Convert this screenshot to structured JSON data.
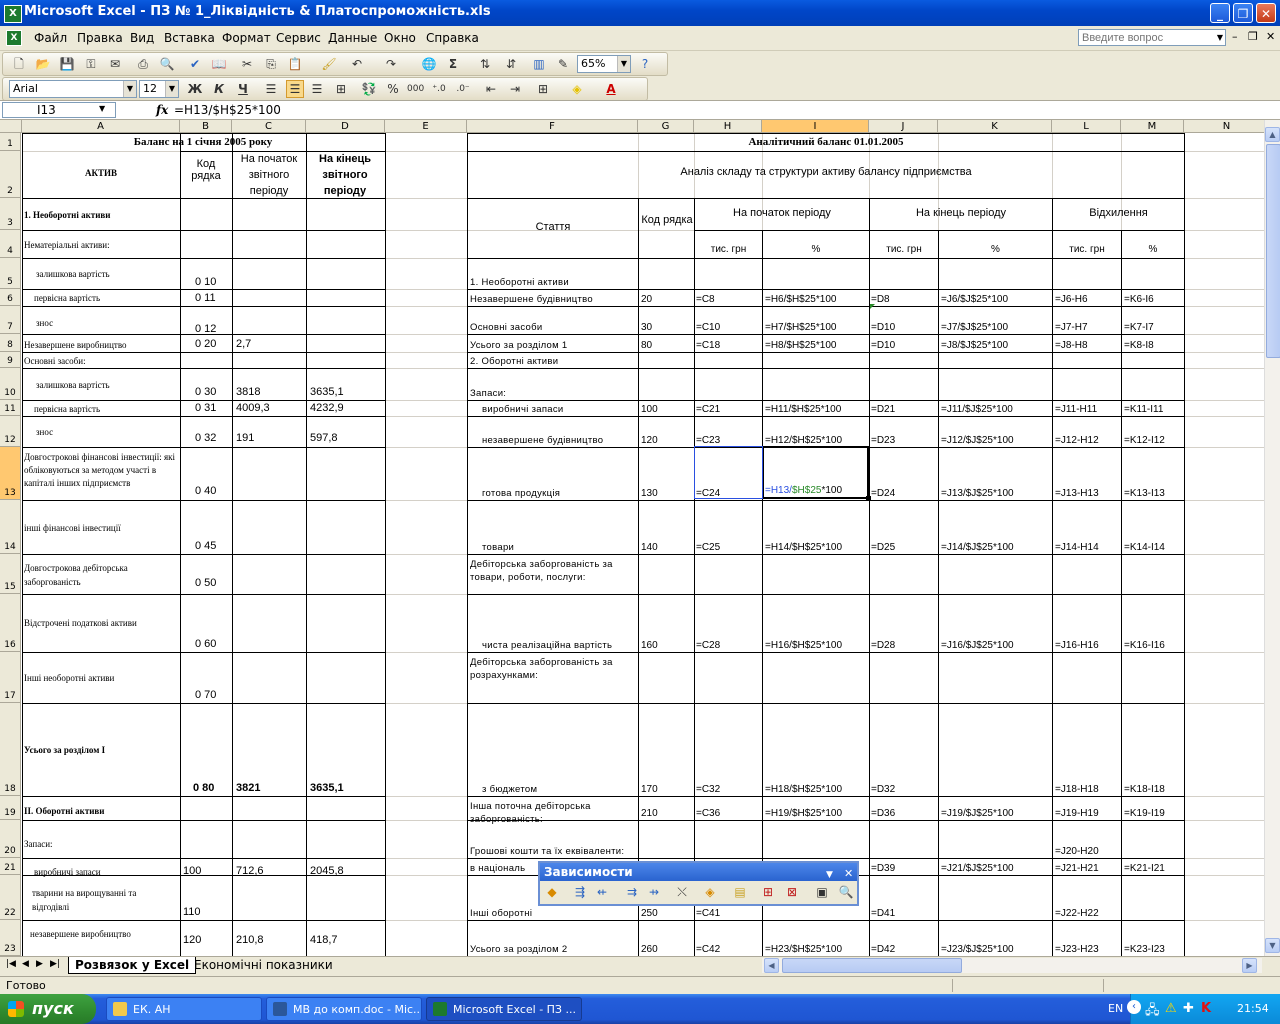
{
  "window": {
    "title": "Microsoft Excel - ПЗ № 1_Ліквідність & Платоспроможність.xls"
  },
  "menu": {
    "items": [
      "Файл",
      "Правка",
      "Вид",
      "Вставка",
      "Формат",
      "Сервис",
      "Данные",
      "Окно",
      "Справка"
    ],
    "help_placeholder": "Введите вопрос"
  },
  "toolbar": {
    "zoom": "65%",
    "font": "Arial",
    "size": "12",
    "bold": "Ж",
    "italic": "К",
    "underline": "Ч"
  },
  "formula_bar": {
    "cell_ref": "I13",
    "fx": "fx",
    "formula": "=H13/$H$25*100"
  },
  "columns": [
    "A",
    "B",
    "C",
    "D",
    "E",
    "F",
    "G",
    "H",
    "I",
    "J",
    "K",
    "L",
    "M",
    "N"
  ],
  "active_cell": {
    "col": "I",
    "row": "13"
  },
  "rows": [
    "1",
    "2",
    "3",
    "4",
    "5",
    "6",
    "7",
    "8",
    "9",
    "10",
    "11",
    "12",
    "13",
    "14",
    "15",
    "16",
    "17",
    "18",
    "19",
    "20",
    "21",
    "22",
    "23"
  ],
  "left_table": {
    "title": "Баланс на 1 січня 2005 року",
    "hdr_activ": "АКТИВ",
    "hdr_code": "Код рядка",
    "hdr_start": "На початок звітного періоду",
    "hdr_end": "На кінець звітного періоду",
    "r3": "1. Необоротні активи",
    "r4": "Нематеріальні активи:",
    "r5": "залишкова вартість",
    "r5_code": "0 10",
    "r6": "первісна вартість",
    "r6_code": "0 11",
    "r7": "знос",
    "r7_code": "0 12",
    "r8": "Незавершене виробництво",
    "r8_code": "0 20",
    "r8_c": "2,7",
    "r9": "Основні засоби:",
    "r10": "залишкова вартість",
    "r10_code": "0 30",
    "r10_c": "3818",
    "r10_d": "3635,1",
    "r11": "первісна вартість",
    "r11_code": "0 31",
    "r11_c": "4009,3",
    "r11_d": "4232,9",
    "r12": "знос",
    "r12_code": "0 32",
    "r12_c": "191",
    "r12_d": "597,8",
    "r13": "Довгострокові фінансові інвестиції: які обліковуються за методом участі в капіталі інших підприємств",
    "r13_code": "0 40",
    "r14": "інші фінансові інвестиції",
    "r14_code": "0 45",
    "r15": "Довгострокова дебіторська заборгованість",
    "r15_code": "0 50",
    "r16": "Відстрочені податкові активи",
    "r16_code": "0 60",
    "r17": "Інші необоротні активи",
    "r17_code": "0 70",
    "r18": "Усього за розділом І",
    "r18_code": "0 80",
    "r18_c": "3821",
    "r18_d": "3635,1",
    "r19": "ІІ. Оборотні активи",
    "r20": "Запаси:",
    "r21": "виробничі запаси",
    "r21_code": "100",
    "r21_c": "712,6",
    "r21_d": "2045,8",
    "r22": "тварини на вирощуванні та відгодівлі",
    "r22_code": "110",
    "r23": "незавершене виробництво",
    "r23_code": "120",
    "r23_c": "210,8",
    "r23_d": "418,7"
  },
  "right_table": {
    "title": "Аналітичний баланс  01.01.2005",
    "subtitle": "Аналіз складу та структури активу балансу підприємства",
    "hdr_item": "Стаття",
    "hdr_code": "Код рядка",
    "hdr_start": "На початок періоду",
    "hdr_end": "На кінець періоду",
    "hdr_dev": "Відхилення",
    "unit_tis": "тис. грн",
    "unit_pct": "%",
    "rows": [
      {
        "f": "1. Необоротні активи",
        "g": "",
        "h": "",
        "i": "",
        "j": "",
        "k": "",
        "l": "",
        "m": ""
      },
      {
        "f": "Незавершене будівництво",
        "g": "20",
        "h": "=C8",
        "i": "=H6/$H$25*100",
        "j": "=D8",
        "k": "=J6/$J$25*100",
        "l": "=J6-H6",
        "m": "=K6-I6"
      },
      {
        "f": "Основні засоби",
        "g": "30",
        "h": "=C10",
        "i": "=H7/$H$25*100",
        "j": "=D10",
        "k": "=J7/$J$25*100",
        "l": "=J7-H7",
        "m": "=K7-I7"
      },
      {
        "f": "Усього за розділом 1",
        "g": "80",
        "h": "=C18",
        "i": "=H8/$H$25*100",
        "j": "=D10",
        "k": "=J8/$J$25*100",
        "l": "=J8-H8",
        "m": "=K8-I8"
      },
      {
        "f": "2. Оборотні активи",
        "g": "",
        "h": "",
        "i": "",
        "j": "",
        "k": "",
        "l": "",
        "m": ""
      },
      {
        "f": "Запаси:",
        "g": "",
        "h": "",
        "i": "",
        "j": "",
        "k": "",
        "l": "",
        "m": ""
      },
      {
        "f": "виробничі запаси",
        "g": "100",
        "h": "=C21",
        "i": "=H11/$H$25*100",
        "j": "=D21",
        "k": "=J11/$J$25*100",
        "l": "=J11-H11",
        "m": "=K11-I11"
      },
      {
        "f": "незавершене будівництво",
        "g": "120",
        "h": "=C23",
        "i": "=H12/$H$25*100",
        "j": "=D23",
        "k": "=J12/$J$25*100",
        "l": "=J12-H12",
        "m": "=K12-I12"
      },
      {
        "f": "готова продукція",
        "g": "130",
        "h": "=C24",
        "i": "=H13/$H$25*100",
        "j": "=D24",
        "k": "=J13/$J$25*100",
        "l": "=J13-H13",
        "m": "=K13-I13"
      },
      {
        "f": "товари",
        "g": "140",
        "h": "=C25",
        "i": "=H14/$H$25*100",
        "j": "=D25",
        "k": "=J14/$J$25*100",
        "l": "=J14-H14",
        "m": "=K14-I14"
      },
      {
        "f": "Дебіторська заборгованість  за товари, роботи, послуги:",
        "g": "",
        "h": "",
        "i": "",
        "j": "",
        "k": "",
        "l": "",
        "m": ""
      },
      {
        "f": "чиста реалізаційна вартість",
        "g": "160",
        "h": "=C28",
        "i": "=H16/$H$25*100",
        "j": "=D28",
        "k": "=J16/$J$25*100",
        "l": "=J16-H16",
        "m": "=K16-I16"
      },
      {
        "f": "Дебіторська заборгованість  за розрахунками:",
        "g": "",
        "h": "",
        "i": "",
        "j": "",
        "k": "",
        "l": "",
        "m": ""
      },
      {
        "f": "з бюджетом",
        "g": "170",
        "h": "=C32",
        "i": "=H18/$H$25*100",
        "j": "=D32",
        "k": "",
        "l": "=J18-H18",
        "m": "=K18-I18"
      },
      {
        "f": "Інша поточна дебіторська заборгованість:",
        "g": "210",
        "h": "=C36",
        "i": "=H19/$H$25*100",
        "j": "=D36",
        "k": "=J19/$J$25*100",
        "l": "=J19-H19",
        "m": "=K19-I19"
      },
      {
        "f": "Грошові кошти та їх еквіваленти:",
        "g": "",
        "h": "",
        "i": "",
        "j": "",
        "k": "",
        "l": "=J20-H20",
        "m": ""
      },
      {
        "f": "в національ",
        "g": "",
        "h": "",
        "i": "",
        "j": "=D39",
        "k": "=J21/$J$25*100",
        "l": "=J21-H21",
        "m": "=K21-I21"
      },
      {
        "f": "Інші оборотні",
        "g": "250",
        "h": "=C41",
        "i": "",
        "j": "=D41",
        "k": "",
        "l": "=J22-H22",
        "m": ""
      },
      {
        "f": "Усього за розділом 2",
        "g": "260",
        "h": "=C42",
        "i": "=H23/$H$25*100",
        "j": "=D42",
        "k": "=J23/$J$25*100",
        "l": "=J23-H23",
        "m": "=K23-I23"
      }
    ],
    "active_ref_h": "=H13/",
    "active_ref_abs": "$H$25",
    "active_ref_tail": "*100"
  },
  "dependencies_toolbar": {
    "title": "Зависимости"
  },
  "sheet_tabs": {
    "active": "Розвязок у Excel",
    "other": "Економічні показники"
  },
  "status": {
    "text": "Готово"
  },
  "taskbar": {
    "start": "пуск",
    "tasks": [
      "ЕК. АН",
      "МВ до комп.doc - Mic...",
      "Microsoft Excel - ПЗ ..."
    ],
    "lang": "EN",
    "clock": "21:54"
  }
}
